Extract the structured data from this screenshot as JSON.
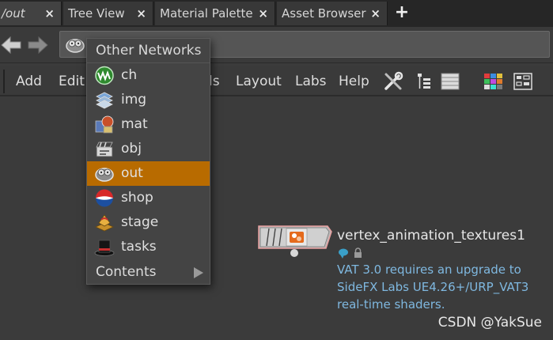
{
  "tabs": [
    {
      "label": "/out",
      "close": "×"
    },
    {
      "label": "Tree View",
      "close": "×"
    },
    {
      "label": "Material Palette",
      "close": "×"
    },
    {
      "label": "Asset Browser",
      "close": "×"
    }
  ],
  "tab_add": "+",
  "menu": {
    "add": "Add",
    "edit": "Edit",
    "tools_partial": "ls",
    "layout": "Layout",
    "labs": "Labs",
    "help": "Help"
  },
  "dropdown": {
    "header": "Other Networks",
    "items": [
      {
        "label": "ch",
        "icon": "ch-network-icon"
      },
      {
        "label": "img",
        "icon": "img-network-icon"
      },
      {
        "label": "mat",
        "icon": "mat-network-icon"
      },
      {
        "label": "obj",
        "icon": "obj-network-icon"
      },
      {
        "label": "out",
        "icon": "out-network-icon"
      },
      {
        "label": "shop",
        "icon": "shop-network-icon"
      },
      {
        "label": "stage",
        "icon": "stage-network-icon"
      },
      {
        "label": "tasks",
        "icon": "tasks-network-icon"
      }
    ],
    "selected": "out",
    "contents": "Contents"
  },
  "node": {
    "name": "vertex_animation_textures1",
    "comment_lines": [
      "VAT 3.0 requires an upgrade to",
      "SideFX Labs UE4.26+/URP_VAT3",
      "real-time shaders."
    ]
  },
  "watermark": "CSDN @YakSue",
  "colors": {
    "selection": "#b86b00",
    "comment": "#7fb8e0",
    "background": "#3b3b3b"
  }
}
